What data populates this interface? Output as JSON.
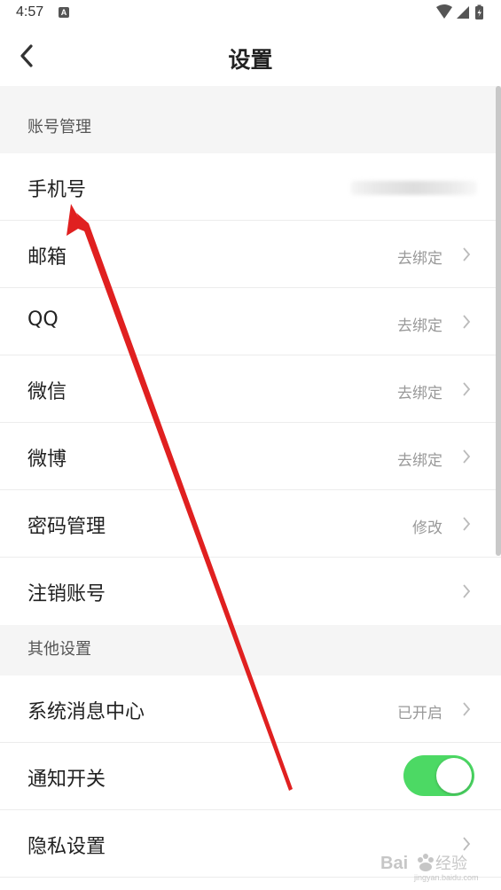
{
  "status_bar": {
    "time": "4:57",
    "notif_letter": "A"
  },
  "header": {
    "title": "设置"
  },
  "sections": [
    {
      "label": "账号管理",
      "rows": [
        {
          "label": "手机号",
          "value": "",
          "chevron": false,
          "blurred": true
        },
        {
          "label": "邮箱",
          "value": "去绑定",
          "chevron": true
        },
        {
          "label": "QQ",
          "value": "去绑定",
          "chevron": true
        },
        {
          "label": "微信",
          "value": "去绑定",
          "chevron": true
        },
        {
          "label": "微博",
          "value": "去绑定",
          "chevron": true
        },
        {
          "label": "密码管理",
          "value": "修改",
          "chevron": true
        },
        {
          "label": "注销账号",
          "value": "",
          "chevron": true
        }
      ]
    },
    {
      "label": "其他设置",
      "rows": [
        {
          "label": "系统消息中心",
          "value": "已开启",
          "chevron": true
        },
        {
          "label": "通知开关",
          "toggle": true,
          "toggle_on": true
        },
        {
          "label": "隐私设置",
          "value": "",
          "chevron": true
        }
      ]
    }
  ],
  "colors": {
    "toggle_on": "#4cd964",
    "section_bg": "#f5f5f5",
    "annotation_arrow": "#e02020"
  },
  "icons": [
    "back-chevron-icon",
    "wifi-icon",
    "cell-signal-icon",
    "battery-icon",
    "chevron-right-icon"
  ],
  "watermark": {
    "text": "Bai 经验",
    "subtext": "jingyan.baidu.com"
  }
}
